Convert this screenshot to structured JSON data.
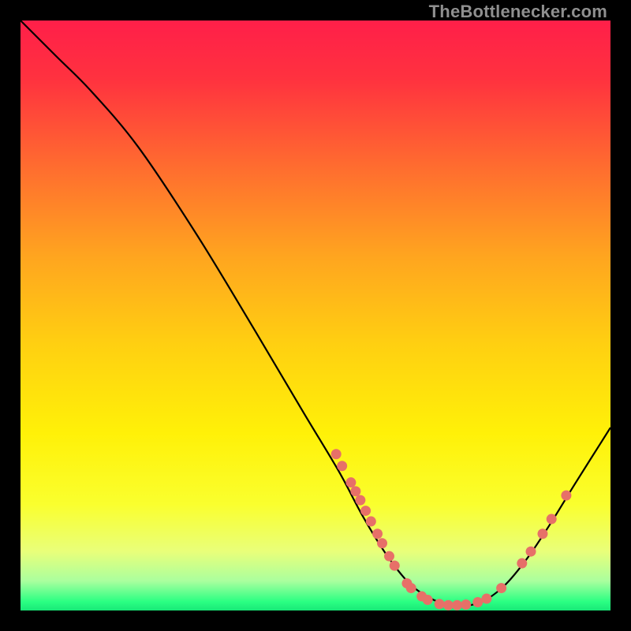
{
  "watermark": "TheBottlenecker.com",
  "chart_data": {
    "type": "line",
    "title": "",
    "xlabel": "",
    "ylabel": "",
    "xlim": [
      0,
      100
    ],
    "ylim": [
      0,
      100
    ],
    "grid": false,
    "legend": false,
    "gradient_stops": [
      {
        "offset": 0.0,
        "color": "#ff1f49"
      },
      {
        "offset": 0.1,
        "color": "#ff323f"
      },
      {
        "offset": 0.25,
        "color": "#ff6d2f"
      },
      {
        "offset": 0.4,
        "color": "#ffa51f"
      },
      {
        "offset": 0.55,
        "color": "#ffd011"
      },
      {
        "offset": 0.7,
        "color": "#fff108"
      },
      {
        "offset": 0.82,
        "color": "#faff2e"
      },
      {
        "offset": 0.9,
        "color": "#e9ff7a"
      },
      {
        "offset": 0.95,
        "color": "#aaff9e"
      },
      {
        "offset": 0.985,
        "color": "#2bff83"
      },
      {
        "offset": 1.0,
        "color": "#18e877"
      }
    ],
    "curve": [
      {
        "x": 0.0,
        "y": 100.0
      },
      {
        "x": 6.0,
        "y": 94.0
      },
      {
        "x": 12.0,
        "y": 88.0
      },
      {
        "x": 20.0,
        "y": 78.5
      },
      {
        "x": 30.0,
        "y": 63.5
      },
      {
        "x": 40.0,
        "y": 47.0
      },
      {
        "x": 48.0,
        "y": 33.5
      },
      {
        "x": 54.0,
        "y": 23.5
      },
      {
        "x": 58.0,
        "y": 16.0
      },
      {
        "x": 62.0,
        "y": 9.5
      },
      {
        "x": 66.0,
        "y": 4.5
      },
      {
        "x": 70.0,
        "y": 1.8
      },
      {
        "x": 74.0,
        "y": 0.8
      },
      {
        "x": 78.0,
        "y": 1.4
      },
      {
        "x": 82.0,
        "y": 4.2
      },
      {
        "x": 86.0,
        "y": 9.0
      },
      {
        "x": 90.0,
        "y": 15.0
      },
      {
        "x": 94.0,
        "y": 21.5
      },
      {
        "x": 100.0,
        "y": 31.0
      }
    ],
    "markers": [
      {
        "x": 53.5,
        "y": 26.5
      },
      {
        "x": 54.5,
        "y": 24.5
      },
      {
        "x": 56.0,
        "y": 21.7
      },
      {
        "x": 56.8,
        "y": 20.2
      },
      {
        "x": 57.6,
        "y": 18.7
      },
      {
        "x": 58.5,
        "y": 16.9
      },
      {
        "x": 59.4,
        "y": 15.1
      },
      {
        "x": 60.5,
        "y": 13.0
      },
      {
        "x": 61.3,
        "y": 11.4
      },
      {
        "x": 62.5,
        "y": 9.2
      },
      {
        "x": 63.4,
        "y": 7.6
      },
      {
        "x": 65.5,
        "y": 4.6
      },
      {
        "x": 66.2,
        "y": 3.8
      },
      {
        "x": 68.0,
        "y": 2.4
      },
      {
        "x": 69.0,
        "y": 1.8
      },
      {
        "x": 71.0,
        "y": 1.1
      },
      {
        "x": 72.5,
        "y": 0.9
      },
      {
        "x": 74.0,
        "y": 0.9
      },
      {
        "x": 75.5,
        "y": 1.0
      },
      {
        "x": 77.5,
        "y": 1.4
      },
      {
        "x": 79.0,
        "y": 2.0
      },
      {
        "x": 81.5,
        "y": 3.8
      },
      {
        "x": 85.0,
        "y": 8.0
      },
      {
        "x": 86.5,
        "y": 10.0
      },
      {
        "x": 88.5,
        "y": 13.0
      },
      {
        "x": 90.0,
        "y": 15.5
      },
      {
        "x": 92.5,
        "y": 19.5
      }
    ],
    "marker_color": "#e77068",
    "curve_color": "#000000",
    "curve_width": 2.2
  }
}
